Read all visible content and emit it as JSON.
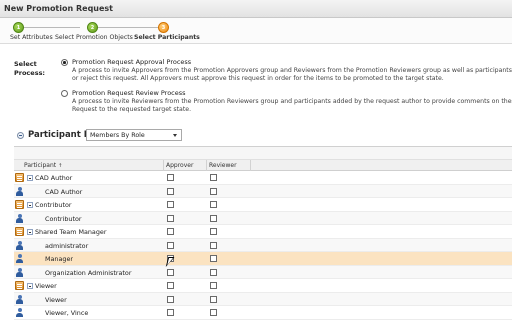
{
  "window": {
    "title": "New Promotion Request"
  },
  "wizard": {
    "steps": [
      {
        "number": "1",
        "label": "Set Attributes",
        "state": "done"
      },
      {
        "number": "2",
        "label": "Select Promotion Objects",
        "state": "done"
      },
      {
        "number": "3",
        "label": "Select Participants",
        "state": "current"
      }
    ],
    "colors": {
      "done": "#6aa628",
      "current": "#f08a10"
    }
  },
  "process": {
    "label": "Select Process:",
    "options": [
      {
        "title": "Promotion Request Approval Process",
        "selected": true,
        "description": [
          "A process to invite Approvers from the Promotion Approvers group and Reviewers from the Promotion Reviewers group as well as participants added by t",
          "or reject this request. All Approvers must approve this request in order for the items to be promoted to the target state."
        ]
      },
      {
        "title": "Promotion Request Review Process",
        "selected": false,
        "description": [
          "A process to invite Reviewers from the Promotion Reviewers group and participants added by the request author to provide comments on these items. Th",
          "Request to the requested target state."
        ]
      }
    ]
  },
  "participant_list": {
    "title": "Participant List",
    "view_select": "Members By Role",
    "columns": {
      "participant": "Participant",
      "approver": "Approver",
      "reviewer": "Reviewer"
    },
    "rows": [
      {
        "label": "CAD Author",
        "type": "group",
        "approver": false,
        "reviewer": false
      },
      {
        "label": "CAD Author",
        "type": "member",
        "approver": false,
        "reviewer": false
      },
      {
        "label": "Contributor",
        "type": "group",
        "approver": false,
        "reviewer": false
      },
      {
        "label": "Contributor",
        "type": "member",
        "approver": false,
        "reviewer": false
      },
      {
        "label": "Shared Team Manager",
        "type": "group",
        "approver": false,
        "reviewer": false
      },
      {
        "label": "administrator",
        "type": "member",
        "approver": false,
        "reviewer": false
      },
      {
        "label": "Manager",
        "type": "member",
        "approver": true,
        "reviewer": false,
        "highlighted": true
      },
      {
        "label": "Organization Administrator",
        "type": "member",
        "approver": false,
        "reviewer": false
      },
      {
        "label": "Viewer",
        "type": "group",
        "approver": false,
        "reviewer": false
      },
      {
        "label": "Viewer",
        "type": "member",
        "approver": false,
        "reviewer": false
      },
      {
        "label": "Viewer, Vince",
        "type": "member",
        "approver": false,
        "reviewer": false
      }
    ],
    "colors": {
      "highlight": "#fbe3c1",
      "group_icon": "#e09a33",
      "user_icon": "#3a67ab"
    }
  }
}
